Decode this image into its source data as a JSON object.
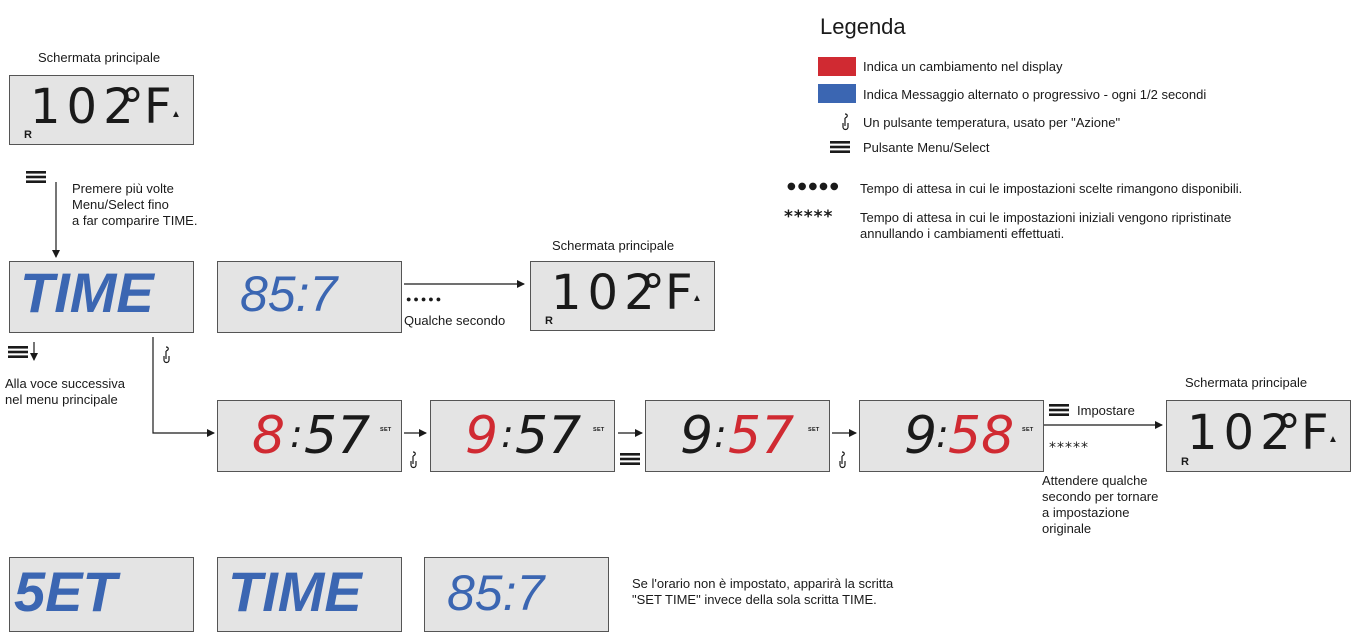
{
  "colors": {
    "change": "#d02a32",
    "alternate": "#3b66b2",
    "lcd": "#e4e4e4"
  },
  "legend": {
    "title": "Legenda",
    "items": [
      {
        "icon": "red-swatch",
        "text": "Indica un cambiamento nel display"
      },
      {
        "icon": "blue-swatch",
        "text": "Indica Messaggio alternato o progressivo - ogni 1/2 secondi"
      },
      {
        "icon": "temp-button-icon",
        "text": "Un pulsante temperatura, usato per \"Azione\""
      },
      {
        "icon": "menu-icon",
        "text": "Pulsante Menu/Select"
      },
      {
        "icon": "dots-icon",
        "symbol": "●●●●●",
        "text": "Tempo di attesa in cui le impostazioni scelte rimangono disponibili."
      },
      {
        "icon": "stars-icon",
        "symbol": "*****",
        "text": "Tempo di attesa in cui le impostazioni iniziali vengono ripristinate",
        "text2": "annullando i cambiamenti effettuati."
      }
    ]
  },
  "main_screen_label": "Schermata principale",
  "main_display": {
    "temp": "102",
    "unit": "°F",
    "r": "R"
  },
  "instructions": {
    "press_menu": [
      "Premere più volte",
      "Menu/Select fino",
      "a far comparire TIME."
    ],
    "next_item": [
      "Alla voce successiva",
      "nel menu principale"
    ],
    "some_seconds": "Qualche secondo",
    "set": "Impostare",
    "wait": [
      "Attendere qualche",
      "secondo per tornare",
      "a impostazione",
      "originale"
    ],
    "not_set_note": [
      "Se l'orario non è impostato, apparirà la scritta",
      "\"SET TIME\" invece della sola scritta TIME."
    ]
  },
  "displays": {
    "time": "TIME",
    "set_word": "5ET",
    "clock_alt": "85:7",
    "step1": {
      "h": "8",
      "m": "57"
    },
    "step2": {
      "h": "9",
      "m": "57"
    },
    "step3": {
      "h": "9",
      "m": "57"
    },
    "step4": {
      "h": "9",
      "m": "58"
    },
    "set_tag": "SET"
  }
}
